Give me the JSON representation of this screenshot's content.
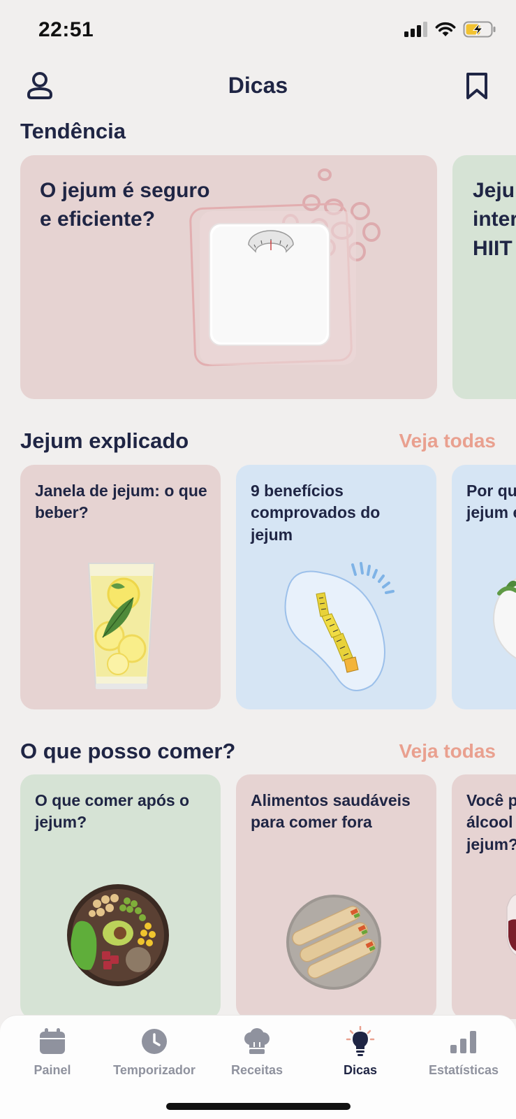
{
  "status_bar": {
    "time": "22:51"
  },
  "header": {
    "title": "Dicas",
    "profile_icon": "user-icon",
    "bookmark_icon": "bookmark-icon"
  },
  "trending": {
    "title": "Tendência",
    "cards": [
      {
        "title_lines": [
          "O jejum é seguro",
          "e eficiente?"
        ],
        "image": "bathroom-scale",
        "color": "#e6d3d2"
      },
      {
        "title_lines": [
          "Jeju",
          "inter",
          "HIIT"
        ],
        "image": "",
        "color": "#d6e3d5"
      }
    ]
  },
  "fasting_explained": {
    "title": "Jejum explicado",
    "see_all": "Veja todas",
    "cards": [
      {
        "title": "Janela de jejum: o que beber?",
        "image": "lemon-water-glass",
        "color": "#e6d3d2"
      },
      {
        "title": "9 benefícios comprovados do jejum",
        "image": "measuring-tape",
        "color": "#d6e5f4"
      },
      {
        "title_lines": [
          "Por qu",
          "jejum e"
        ],
        "image": "salad-plate",
        "color": "#d6e5f4"
      }
    ]
  },
  "what_to_eat": {
    "title": "O que posso comer?",
    "see_all": "Veja todas",
    "cards": [
      {
        "title": "O que comer após o jejum?",
        "image": "buddha-bowl",
        "color": "#d6e3d5"
      },
      {
        "title": "Alimentos saudáveis para comer fora",
        "image": "wraps-plate",
        "color": "#e6d3d2"
      },
      {
        "title_lines": [
          "Você p",
          "álcool",
          "jejum?"
        ],
        "image": "wine-glass",
        "color": "#e6d3d2"
      }
    ]
  },
  "bottom_nav": {
    "items": [
      {
        "label": "Painel",
        "icon": "calendar-icon"
      },
      {
        "label": "Temporizador",
        "icon": "clock-icon"
      },
      {
        "label": "Receitas",
        "icon": "chef-hat-icon"
      },
      {
        "label": "Dicas",
        "icon": "lightbulb-icon",
        "active": true
      },
      {
        "label": "Estatísticas",
        "icon": "bar-chart-icon"
      }
    ]
  },
  "colors": {
    "navy": "#1f2544",
    "accent": "#e9a08f",
    "inactive": "#8f929e",
    "background": "#f1efee"
  }
}
